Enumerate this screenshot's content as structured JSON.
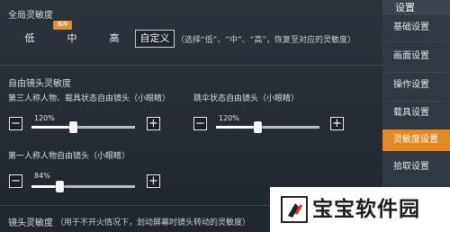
{
  "global": {
    "title": "全局灵敏度",
    "options": [
      "低",
      "中",
      "高",
      "自定义"
    ],
    "selected": "自定义",
    "recommend_tag": "推荐",
    "hint": "（选择“低”、“中”、“高”，恢复至对应的灵敏度）"
  },
  "free_look": {
    "title": "自由镜头灵敏度",
    "third_person": {
      "label": "第三人称人物、载具状态自由镜头（小眼睛）",
      "value_text": "120%",
      "fraction": 0.4
    },
    "parachute": {
      "label": "跳伞状态自由镜头（小眼睛）",
      "value_text": "120%",
      "fraction": 0.4
    },
    "first_person": {
      "label": "第一人称人物自由镜头（小眼睛）",
      "value_text": "84%",
      "fraction": 0.27
    }
  },
  "camera": {
    "title": "镜头灵敏度",
    "hint": "（用于不开火情况下，划动屏幕时镜头转动的灵敏度）"
  },
  "buttons": {
    "minus": "−",
    "plus": "+"
  },
  "sidebar": {
    "header": "设置",
    "items": [
      "基础设置",
      "画面设置",
      "操作设置",
      "载具设置",
      "灵敏度设置",
      "拾取设置"
    ],
    "active": "灵敏度设置"
  },
  "watermark": {
    "text": "宝宝软件园"
  },
  "colors": {
    "accent": "#e58a22",
    "panel": "#2a323b",
    "sidebar": "#303841"
  }
}
